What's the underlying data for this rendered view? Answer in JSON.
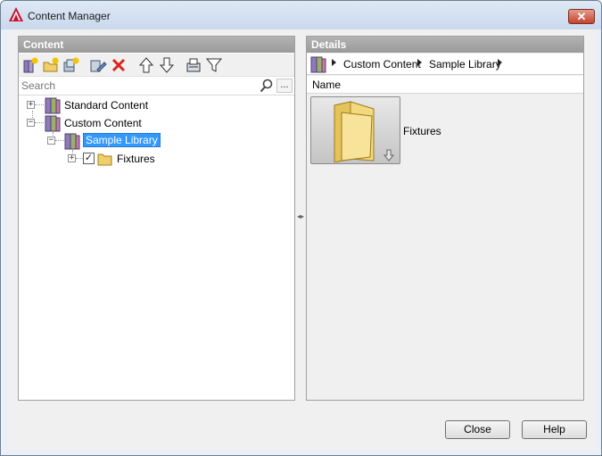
{
  "window": {
    "title": "Content Manager",
    "close_symbol": "✕"
  },
  "content_panel": {
    "header": "Content",
    "toolbar": [
      {
        "name": "new-library-icon"
      },
      {
        "name": "new-folder-icon"
      },
      {
        "name": "add-content-icon"
      },
      {
        "name": "edit-icon"
      },
      {
        "name": "delete-icon"
      },
      {
        "name": "move-up-icon"
      },
      {
        "name": "move-down-icon"
      },
      {
        "name": "view-options-icon"
      },
      {
        "name": "filter-icon"
      }
    ],
    "search": {
      "placeholder": "Search",
      "value": "",
      "more_label": "..."
    },
    "tree": [
      {
        "label": "Standard Content",
        "expander": "+",
        "level": 0
      },
      {
        "label": "Custom Content",
        "expander": "−",
        "level": 0
      },
      {
        "label": "Sample Library",
        "expander": "−",
        "level": 1,
        "selected": true
      },
      {
        "label": "Fixtures",
        "expander": "+",
        "level": 2,
        "checked": true
      }
    ]
  },
  "details_panel": {
    "header": "Details",
    "breadcrumb": [
      "Custom Content",
      "Sample Library"
    ],
    "column_header": "Name",
    "items": [
      {
        "label": "Fixtures",
        "icon": "folder-icon"
      }
    ]
  },
  "buttons": {
    "close": "Close",
    "help": "Help"
  },
  "colors": {
    "selection": "#3399ff",
    "header_gray": "#a6a6a6",
    "delete_red": "#d9261c"
  }
}
